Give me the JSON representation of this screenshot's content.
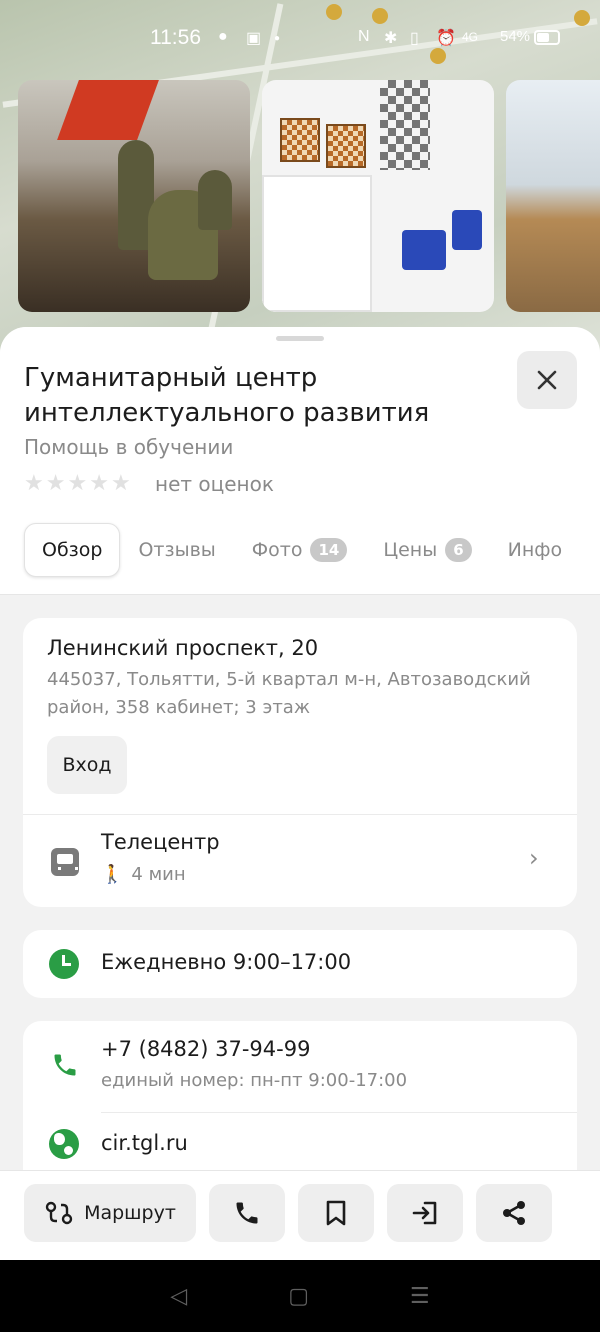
{
  "status_bar": {
    "time": "11:56",
    "battery": "54%",
    "network": "4G"
  },
  "place": {
    "title": "Гуманитарный центр интеллектуального развития",
    "category": "Помощь в обучении",
    "rating_text": "нет оценок",
    "rating_stars": 0
  },
  "tabs": [
    {
      "label": "Обзор",
      "badge": ""
    },
    {
      "label": "Отзывы",
      "badge": ""
    },
    {
      "label": "Фото",
      "badge": "14"
    },
    {
      "label": "Цены",
      "badge": "6"
    },
    {
      "label": "Инфо",
      "badge": ""
    }
  ],
  "address": {
    "main": "Ленинский проспект, 20",
    "details": "445037, Тольятти, 5-й квартал м-н, Автозаводский район, 358 кабинет; 3 этаж",
    "entry_button": "Вход"
  },
  "transit": {
    "stop": "Телецентр",
    "walk_time": "4 мин"
  },
  "hours": "Ежедневно 9:00–17:00",
  "contacts": {
    "phone": "+7 (8482) 37-94-99",
    "phone_note": "единый номер: пн-пт 9:00-17:00",
    "website": "cir.tgl.ru"
  },
  "actions": {
    "route_label": "Маршрут"
  },
  "colors": {
    "accent_green": "#2a9d45",
    "muted_text": "#8a8a8a",
    "button_bg": "#eeeeee"
  }
}
